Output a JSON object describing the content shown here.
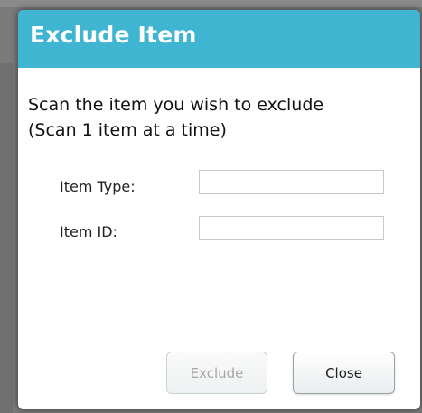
{
  "dialog": {
    "title": "Exclude Item",
    "instruction_line1": "Scan the item you wish to exclude",
    "instruction_line2": "(Scan 1 item at a time)",
    "fields": {
      "item_type_label": "Item Type:",
      "item_type_value": "",
      "item_id_label": "Item ID:",
      "item_id_value": ""
    },
    "buttons": {
      "exclude_label": "Exclude",
      "exclude_enabled": false,
      "close_label": "Close"
    }
  },
  "colors": {
    "header": "#3fb5d2",
    "title_text": "#ffffff",
    "overlay": "#7a7a7a"
  }
}
